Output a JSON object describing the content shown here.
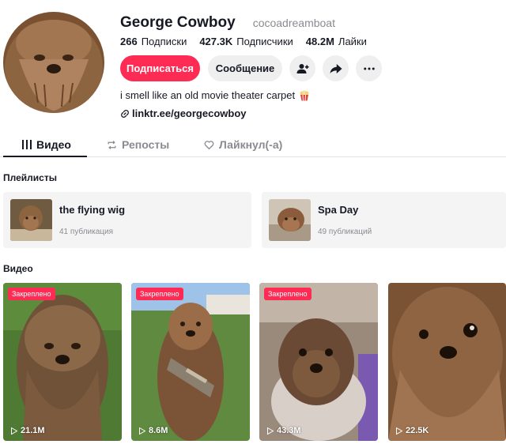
{
  "profile": {
    "name": "George Cowboy",
    "handle": "cocoadreamboat",
    "stats": [
      {
        "value": "266",
        "label": "Подписки"
      },
      {
        "value": "427.3K",
        "label": "Подписчики"
      },
      {
        "value": "48.2M",
        "label": "Лайки"
      }
    ],
    "follow_label": "Подписаться",
    "message_label": "Сообщение",
    "bio": "i smell like an old movie theater carpet",
    "link": "linktr.ee/georgecowboy"
  },
  "tabs": [
    {
      "label": "Видео",
      "icon": "grid-icon",
      "active": true
    },
    {
      "label": "Репосты",
      "icon": "repost-icon",
      "active": false
    },
    {
      "label": "Лайкнул(-а)",
      "icon": "heart-icon",
      "active": false
    }
  ],
  "playlists_title": "Плейлисты",
  "playlists": [
    {
      "title": "the flying wig",
      "count": "41 публикация"
    },
    {
      "title": "Spa Day",
      "count": "49 публикаций"
    }
  ],
  "videos_title": "Видео",
  "videos": [
    {
      "pinned": true,
      "badge": "Закреплено",
      "views": "21.1M"
    },
    {
      "pinned": true,
      "badge": "Закреплено",
      "views": "8.6M"
    },
    {
      "pinned": true,
      "badge": "Закреплено",
      "views": "43.3M"
    },
    {
      "pinned": false,
      "badge": "",
      "views": "22.5K"
    }
  ],
  "colors": {
    "accent": "#fe2c55",
    "text": "#161823",
    "muted": "#8a8b91",
    "chip_bg": "#efeff0"
  }
}
